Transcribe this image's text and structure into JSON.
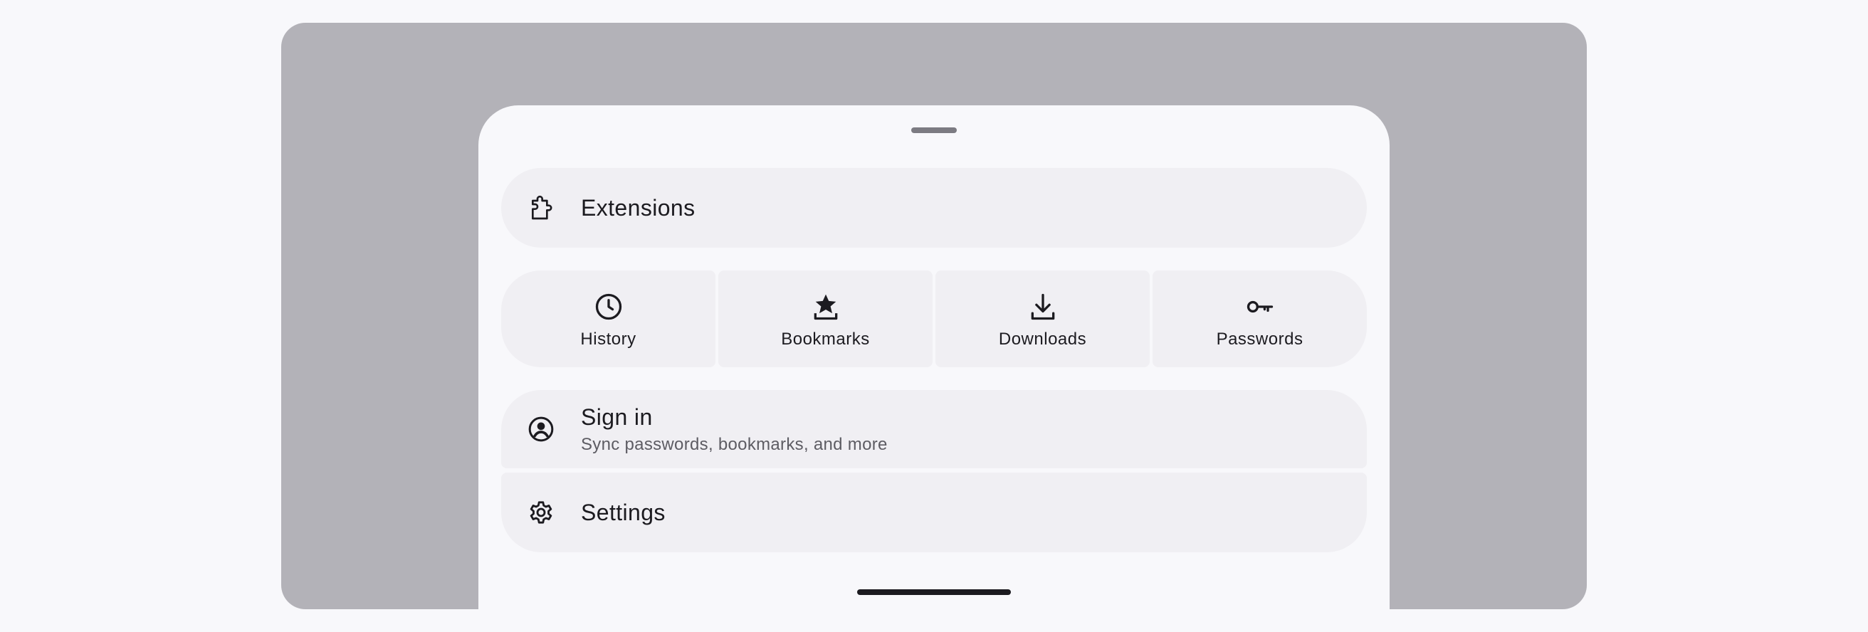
{
  "menu": {
    "extensions": {
      "label": "Extensions",
      "icon": "puzzle-icon"
    },
    "quick_tiles": [
      {
        "label": "History",
        "icon": "clock-icon"
      },
      {
        "label": "Bookmarks",
        "icon": "star-icon"
      },
      {
        "label": "Downloads",
        "icon": "download-icon"
      },
      {
        "label": "Passwords",
        "icon": "key-icon"
      }
    ],
    "sign_in": {
      "label": "Sign in",
      "sublabel": "Sync passwords, bookmarks, and more",
      "icon": "account-circle-icon"
    },
    "settings": {
      "label": "Settings",
      "icon": "gear-icon"
    }
  },
  "colors": {
    "page_background": "#f8f8fb",
    "device_frame": "#b3b2b8",
    "sheet_background": "#f8f8fb",
    "item_background": "#f0eff3",
    "text_primary": "#1c1b20",
    "text_secondary": "#5d5c63",
    "drag_handle": "#7c7b82"
  }
}
